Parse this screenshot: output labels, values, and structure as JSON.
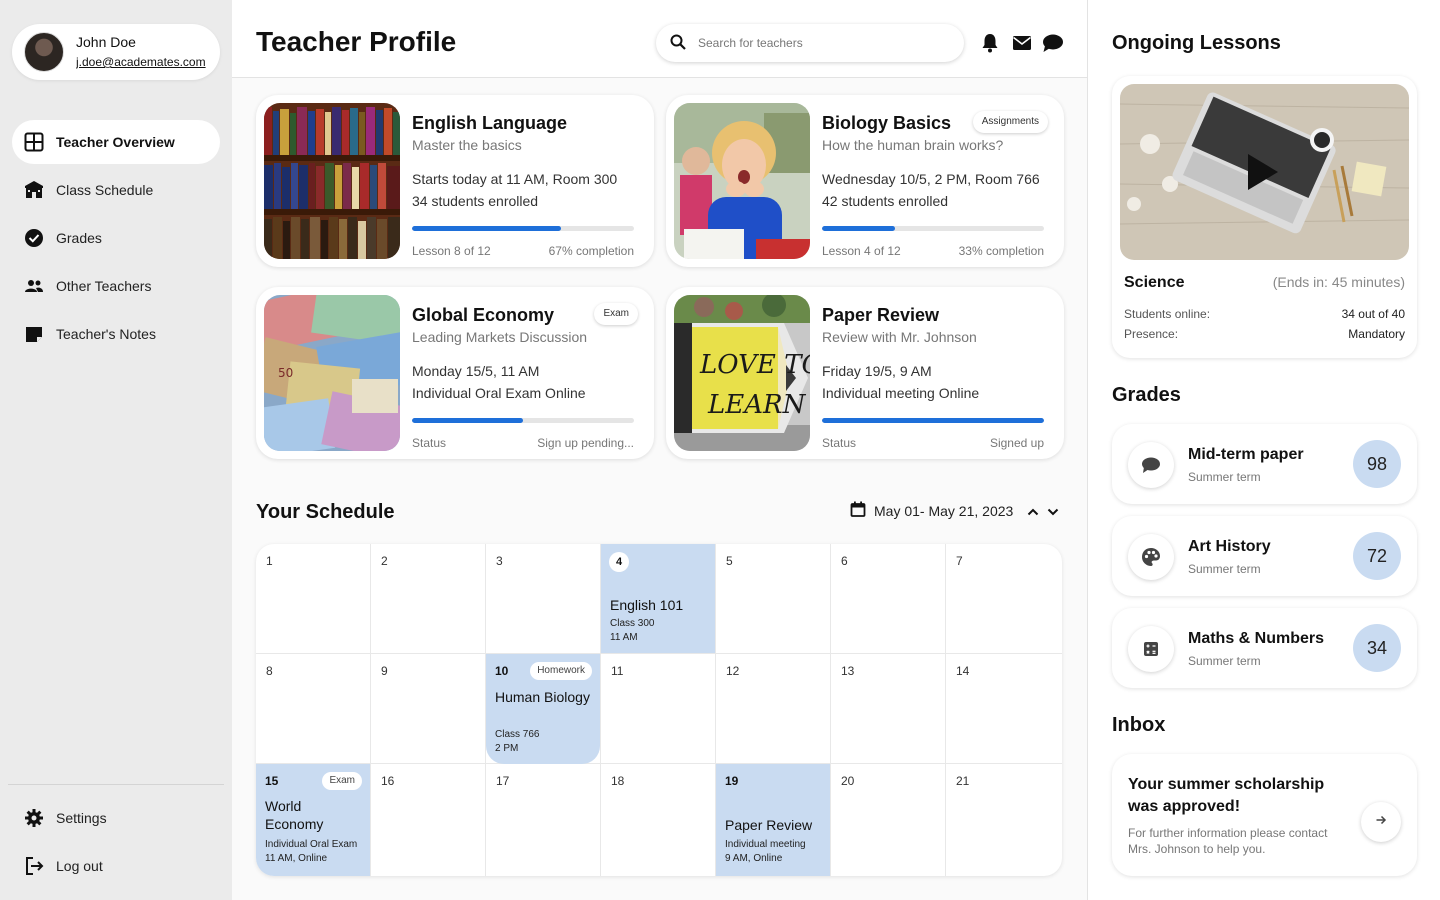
{
  "user": {
    "name": "John Doe",
    "email": "j.doe@academates.com"
  },
  "nav": {
    "items": [
      {
        "label": "Teacher Overview",
        "icon": "dashboard-icon",
        "active": true
      },
      {
        "label": "Class Schedule",
        "icon": "school-icon"
      },
      {
        "label": "Grades",
        "icon": "check-circle-icon"
      },
      {
        "label": "Other Teachers",
        "icon": "people-icon"
      },
      {
        "label": "Teacher's Notes",
        "icon": "note-icon"
      }
    ],
    "bottom": [
      {
        "label": "Settings",
        "icon": "gear-icon"
      },
      {
        "label": "Log out",
        "icon": "logout-icon"
      }
    ]
  },
  "header": {
    "title": "Teacher Profile",
    "search_placeholder": "Search for teachers",
    "icons": [
      "bell-icon",
      "mail-icon",
      "chat-icon"
    ]
  },
  "courses": [
    {
      "title": "English Language",
      "subtitle": "Master the basics",
      "line1": "Starts today at 11 AM, Room 300",
      "line2": "34 students enrolled",
      "progress": 0.67,
      "left_label": "Lesson 8 of 12",
      "right_label": "67% completion",
      "badge": ""
    },
    {
      "title": "Biology Basics",
      "subtitle": "How the human brain works?",
      "line1": "Wednesday 10/5, 2 PM, Room 766",
      "line2": "42 students enrolled",
      "progress": 0.33,
      "left_label": "Lesson 4 of 12",
      "right_label": "33% completion",
      "badge": "Assignments"
    },
    {
      "title": "Global Economy",
      "subtitle": "Leading Markets Discussion",
      "line1": "Monday 15/5, 11 AM",
      "line2": "Individual Oral Exam Online",
      "progress": 0.5,
      "left_label": "Status",
      "right_label": "Sign up pending...",
      "badge": "Exam"
    },
    {
      "title": "Paper Review",
      "subtitle": "Review with Mr. Johnson",
      "line1": "Friday 19/5, 9 AM",
      "line2": "Individual meeting Online",
      "progress": 1.0,
      "left_label": "Status",
      "right_label": "Signed up",
      "badge": ""
    }
  ],
  "schedule": {
    "title": "Your Schedule",
    "range": "May 01- May 21, 2023",
    "days": [
      "1",
      "2",
      "3",
      "4",
      "5",
      "6",
      "7",
      "8",
      "9",
      "10",
      "11",
      "12",
      "13",
      "14",
      "15",
      "16",
      "17",
      "18",
      "19",
      "20",
      "21"
    ],
    "events": [
      {
        "day": "4",
        "title": "English 101",
        "d1": "Class 300",
        "d2": "11 AM",
        "badge": ""
      },
      {
        "day": "10",
        "title": "Human Biology",
        "d1": "Class 766",
        "d2": "2 PM",
        "badge": "Homework"
      },
      {
        "day": "15",
        "title": "World Economy",
        "d1": "Individual Oral Exam",
        "d2": "11 AM, Online",
        "badge": "Exam"
      },
      {
        "day": "19",
        "title": "Paper Review",
        "d1": "Individual meeting",
        "d2": "9 AM, Online",
        "badge": ""
      }
    ]
  },
  "ongoing": {
    "title": "Ongoing Lessons",
    "lesson": "Science",
    "ends": "(Ends in: 45 minutes)",
    "students_label": "Students online:",
    "students_value": "34 out of 40",
    "presence_label": "Presence:",
    "presence_value": "Mandatory"
  },
  "grades": {
    "title": "Grades",
    "items": [
      {
        "title": "Mid-term paper",
        "sub": "Summer term",
        "score": "98",
        "icon": "chat-bubble-icon"
      },
      {
        "title": "Art History",
        "sub": "Summer term",
        "score": "72",
        "icon": "palette-icon"
      },
      {
        "title": "Maths & Numbers",
        "sub": "Summer term",
        "score": "34",
        "icon": "calculator-icon"
      }
    ]
  },
  "inbox": {
    "title": "Inbox",
    "message_title": "Your summer scholarship was approved!",
    "message_body": "For further information please contact Mrs. Johnson to help you."
  },
  "colors": {
    "accent": "#1e6fd9",
    "event_bg": "#c9dbf1",
    "sidebar_bg": "#ebebeb"
  }
}
